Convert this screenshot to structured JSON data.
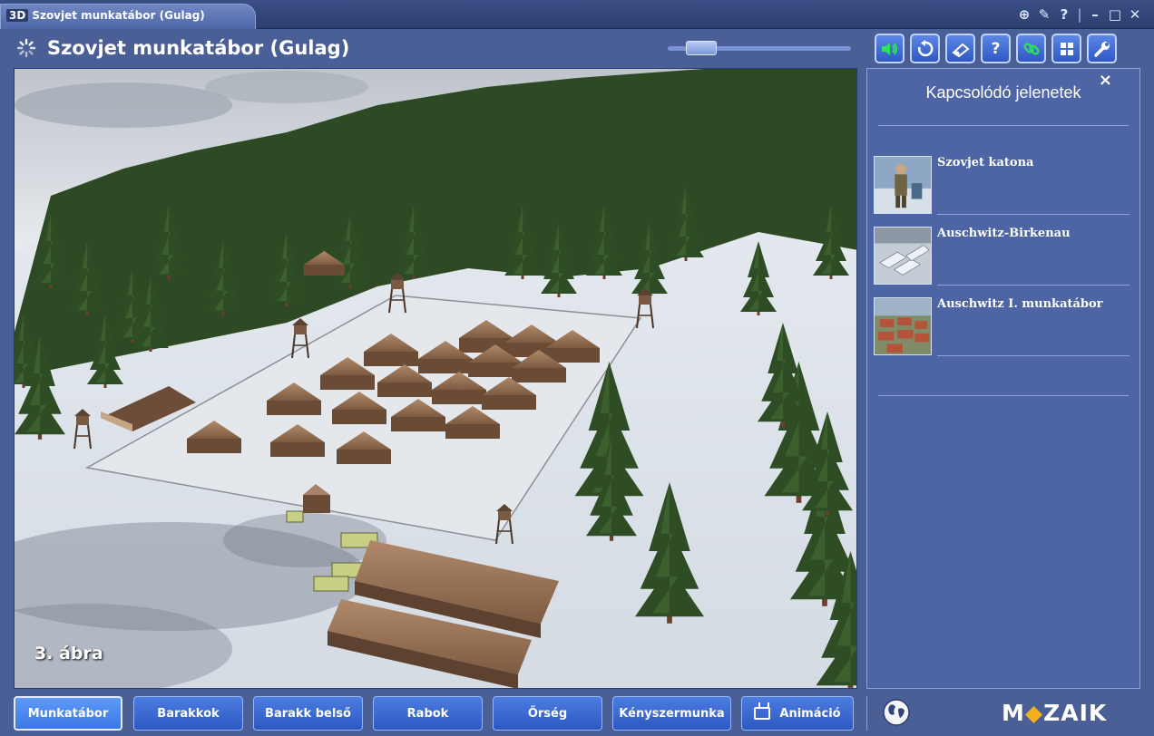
{
  "window": {
    "badge": "3D",
    "tab_title": "Szovjet munkatábor (Gulag)",
    "controls": [
      "⊕",
      "✎",
      "?",
      "|",
      "–",
      "□",
      "✕"
    ]
  },
  "header": {
    "title": "Szovjet munkatábor (Gulag)",
    "slider_value": 0.12,
    "toolbar": [
      {
        "name": "sound-icon",
        "glyph": "🔊"
      },
      {
        "name": "reset-icon",
        "glyph": "↻"
      },
      {
        "name": "camera-icon",
        "glyph": "⌁"
      },
      {
        "name": "help-icon",
        "glyph": "?"
      },
      {
        "name": "link-icon",
        "glyph": "∞"
      },
      {
        "name": "grid-icon",
        "glyph": "▦"
      },
      {
        "name": "settings-wrench-icon",
        "glyph": "🔧"
      }
    ]
  },
  "viewport": {
    "figure_label": "3. ábra"
  },
  "panel": {
    "close": "×",
    "title": "Kapcsolódó jelenetek",
    "items": [
      {
        "label": "Szovjet katona"
      },
      {
        "label": "Auschwitz-Birkenau"
      },
      {
        "label": "Auschwitz I. munkatábor"
      }
    ]
  },
  "nav": {
    "buttons": [
      {
        "label": "Munkatábor",
        "active": true
      },
      {
        "label": "Barakkok"
      },
      {
        "label": "Barakk belső"
      },
      {
        "label": "Rabok"
      },
      {
        "label": "Őrség"
      },
      {
        "label": "Kényszermunka"
      },
      {
        "label": "Animáció"
      }
    ],
    "logo": {
      "left": "M",
      "diamond": "◆",
      "right": "ZAIK"
    }
  },
  "colors": {
    "background": "#4a5f95",
    "button": "#2f5cc8",
    "active_button": "#4a86ee",
    "logo_accent": "#f2b01e"
  }
}
